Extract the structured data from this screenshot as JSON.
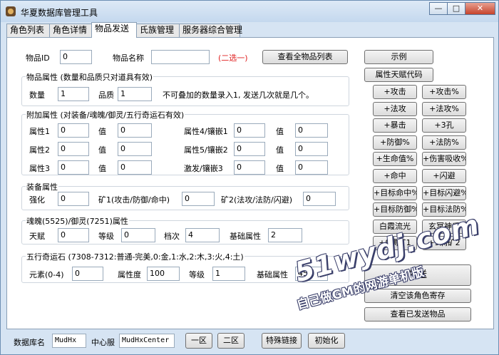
{
  "window": {
    "title": "华夏数据库管理工具",
    "minimize": "—",
    "maximize": "□",
    "close": "✕"
  },
  "tabs": [
    "角色列表",
    "角色详情",
    "物品发送",
    "氏族管理",
    "服务器综合管理"
  ],
  "item": {
    "id_label": "物品ID",
    "id_value": "0",
    "name_label": "物品名称",
    "name_value": "",
    "choose_hint": "(二选一)",
    "view_all_button": "查看全物品列表"
  },
  "props": {
    "title": "物品属性 (数量和品质只对道具有效)",
    "qty_label": "数量",
    "qty_value": "1",
    "quality_label": "品质",
    "quality_value": "1",
    "note": "不可叠加的数量录入1, 发送几次就是几个。"
  },
  "extra": {
    "title": "附加属性 (对装备/魂魄/御灵/五行奇运石有效)",
    "value_label": "值",
    "left_rows": [
      {
        "label": "属性1",
        "attr": "0",
        "value": "0"
      },
      {
        "label": "属性2",
        "attr": "0",
        "value": "0"
      },
      {
        "label": "属性3",
        "attr": "0",
        "value": "0"
      }
    ],
    "right_rows": [
      {
        "label": "属性4/镶嵌1",
        "attr": "0",
        "value": "0"
      },
      {
        "label": "属性5/镶嵌2",
        "attr": "0",
        "value": "0"
      },
      {
        "label": "激发/镶嵌3",
        "attr": "0",
        "value": "0"
      }
    ]
  },
  "equip": {
    "title": "装备属性",
    "enhance_label": "强化",
    "enhance_value": "0",
    "mine1_label": "矿1(攻击/防御/命中)",
    "mine1_value": "0",
    "mine2_label": "矿2(法攻/法防/闪避)",
    "mine2_value": "0"
  },
  "soul": {
    "title": "魂魄(5525)/御灵(7251)属性",
    "talent_label": "天赋",
    "talent_value": "0",
    "level_label": "等级",
    "level_value": "0",
    "tier_label": "档次",
    "tier_value": "4",
    "base_label": "基础属性",
    "base_value": "2"
  },
  "stone": {
    "title": "五行奇运石 (7308-7312:普通-完美,0:金,1:水,2:木,3:火,4:土)",
    "element_label": "元素(0-4)",
    "element_value": "0",
    "attr_label": "属性度",
    "attr_value": "100",
    "level_label": "等级",
    "level_value": "1",
    "base_label": "基础属性",
    "base_value": "45"
  },
  "side_buttons": {
    "example": "示例",
    "talent_code": "属性天赋代码",
    "grid": [
      [
        "+攻击",
        "+攻击%"
      ],
      [
        "+法攻",
        "+法攻%"
      ],
      [
        "+暴击",
        "+3孔"
      ],
      [
        "+防御%",
        "+法防%"
      ],
      [
        "+生命值%",
        "+伤害吸收%"
      ],
      [
        "+命中",
        "+闪避"
      ],
      [
        "+目标命中%",
        "+目标闪避%"
      ],
      [
        "+目标防御%",
        "+目标法防%"
      ],
      [
        "白霞流光",
        "玄冥神盾"
      ],
      [
        "+9满矿1",
        "+9满矿2"
      ]
    ],
    "send": "发送",
    "clear_store": "清空该角色寄存",
    "view_sent": "查看已发送物品"
  },
  "bottom": {
    "db_label": "数据库名",
    "db_value": "MudHx",
    "center_label": "中心服",
    "center_value": "MudHxCenter",
    "zone1": "一区",
    "zone2": "二区",
    "special_link": "特殊链接",
    "init": "初始化"
  },
  "watermark": {
    "site": "51wydj.com",
    "slogan": "自己做GM的网游单机版"
  }
}
